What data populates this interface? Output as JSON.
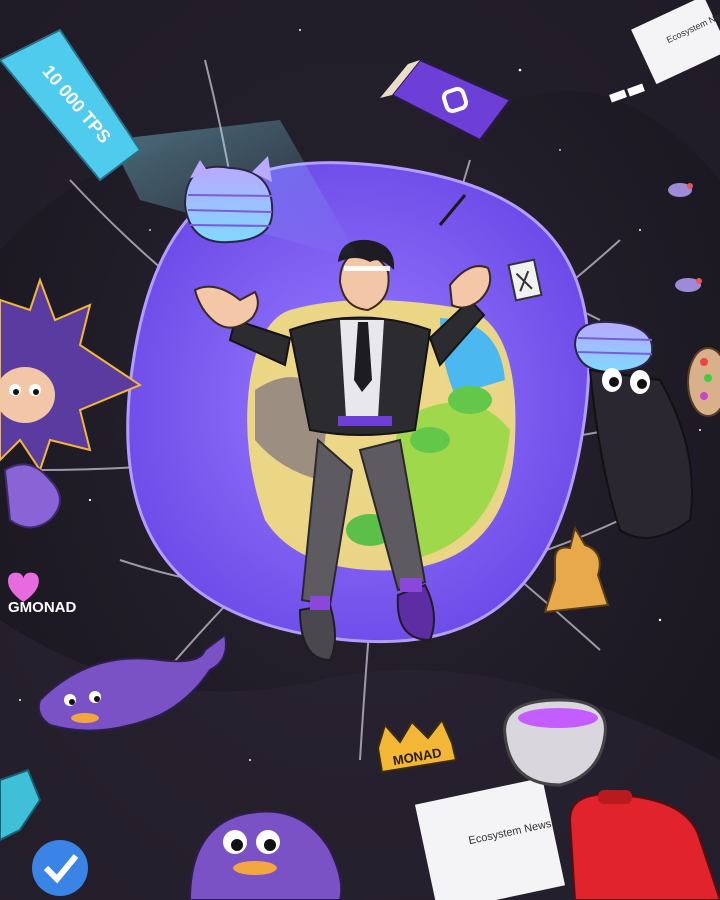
{
  "texts": {
    "banner": "10 000 TPS",
    "gmonad": "GMONAD",
    "crown": "MONAD",
    "news_top": "Ecosystem News",
    "news_bottom": "Ecosystem News"
  },
  "colors": {
    "background": "#1d1a24",
    "portal": "#7e5cf5",
    "portal_border": "#a48cff",
    "banner": "#5bd3f0",
    "accent_purple": "#6e3fd6",
    "gold": "#f2b735",
    "red_bag": "#e1242c"
  },
  "icons": {
    "book": "book-icon",
    "verified": "verified-badge-icon",
    "heart": "heart-icon"
  }
}
